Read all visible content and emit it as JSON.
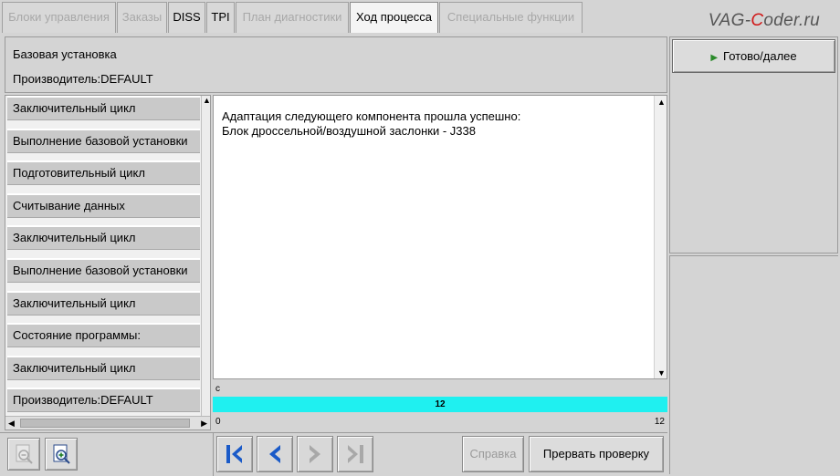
{
  "tabs": [
    {
      "label": "Блоки управления",
      "state": "disabled"
    },
    {
      "label": "Заказы",
      "state": "disabled"
    },
    {
      "label": "DISS",
      "state": "enabled"
    },
    {
      "label": "TPI",
      "state": "enabled"
    },
    {
      "label": "План диагностики",
      "state": "disabled"
    },
    {
      "label": "Ход процесса",
      "state": "active"
    },
    {
      "label": "Специальные функции",
      "state": "disabled"
    }
  ],
  "watermark": {
    "before": "VAG-",
    "accent": "C",
    "after": "oder.ru"
  },
  "header": {
    "title": "Базовая установка",
    "manufacturer": "Производитель:DEFAULT"
  },
  "steps": [
    "Заключительный цикл",
    "Выполнение базовой установки",
    "Подготовительный цикл",
    "Считывание данных",
    "Заключительный цикл",
    "Выполнение базовой установки",
    "Заключительный цикл",
    "Состояние программы:",
    "Заключительный цикл",
    "Производитель:DEFAULT"
  ],
  "message": {
    "line1": "Адаптация следующего компонента прошла успешно:",
    "line2": "Блок дроссельной/воздушной заслонки - J338"
  },
  "progress": {
    "unit": "c",
    "value": "12",
    "min": "0",
    "max": "12",
    "fraction": 1.0,
    "fill_color": "#1ff0f0"
  },
  "actions": {
    "ready": "Готово/далее",
    "help": "Справка",
    "abort": "Прервать проверку"
  },
  "icons": {
    "zoom_out": "zoom-out-icon",
    "zoom_in": "zoom-in-icon",
    "first": "skip-to-first-icon",
    "back": "back-icon",
    "forward": "forward-icon",
    "last": "skip-to-last-icon"
  }
}
